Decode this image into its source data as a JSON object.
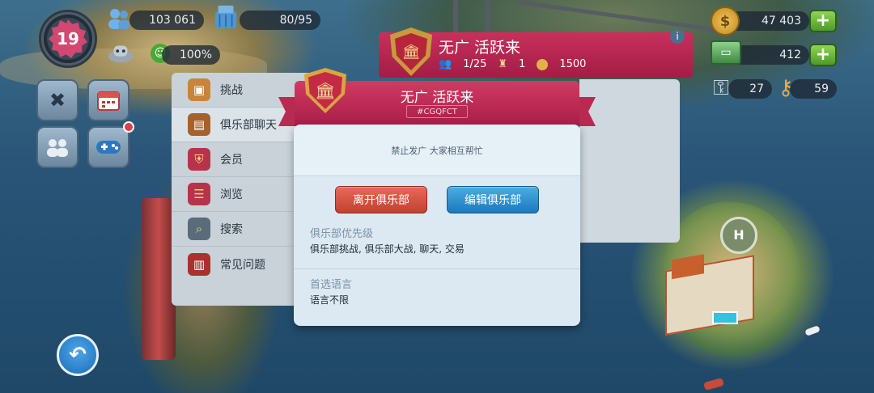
{
  "hud": {
    "level": "19",
    "population": "103 061",
    "workers": "80/95",
    "happiness": "100%",
    "simoleons": "47 403",
    "simcash": "412",
    "golden_keys": "27",
    "keys": "59"
  },
  "club_banner": {
    "name": "无广 活跃来",
    "members": "1/25",
    "trophies": "1",
    "points": "1500"
  },
  "side_menu": {
    "items": [
      {
        "label": "挑战",
        "icon": "chest-icon"
      },
      {
        "label": "俱乐部聊天",
        "icon": "chat-icon"
      },
      {
        "label": "会员",
        "icon": "shield-icon"
      },
      {
        "label": "浏览",
        "icon": "list-icon"
      },
      {
        "label": "搜索",
        "icon": "magnifier-icon"
      },
      {
        "label": "常见问题",
        "icon": "book-icon"
      }
    ]
  },
  "dialog": {
    "club_name": "无广 活跃来",
    "club_tag": "#CGQFCT",
    "description": "禁止发广 大家相互帮忙",
    "leave_label": "离开俱乐部",
    "edit_label": "编辑俱乐部",
    "priority_label": "俱乐部优先级",
    "priority_value": "俱乐部挑战, 俱乐部大战, 聊天, 交易",
    "language_label": "首选语言",
    "language_value": "语言不限"
  },
  "colors": {
    "ribbon": "#c4305a",
    "leave_button": "#d9533f",
    "edit_button": "#2f8fd0",
    "dialog_bg": "#dce9f2"
  }
}
